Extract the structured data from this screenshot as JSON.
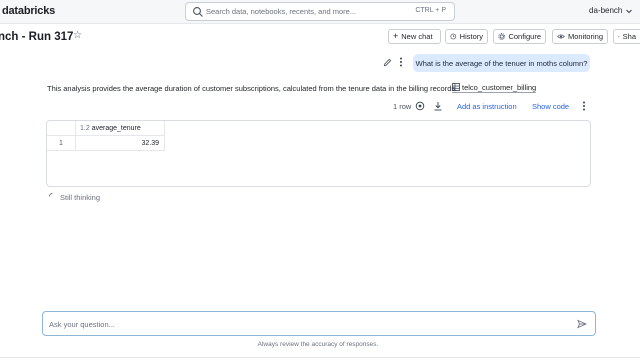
{
  "app": {
    "logo": "databricks",
    "search_placeholder": "Search data, notebooks, recents, and more...",
    "search_shortcut": "CTRL + P",
    "workspace": "da-bench"
  },
  "header": {
    "title": "nch - Run 317",
    "buttons": {
      "new_chat": "New chat",
      "history": "History",
      "configure": "Configure",
      "monitoring": "Monitoring",
      "share": "Sha"
    }
  },
  "conversation": {
    "user_question": "What is the average of the tenuer in moths column?",
    "answer_text": "This analysis provides the average duration of customer subscriptions, calculated from the tenure data in the billing records.",
    "table_tag": "telco_customer_billing",
    "result": {
      "row_count": "1 row",
      "add_instruction": "Add as instruction",
      "show_code": "Show code",
      "columns": [
        {
          "type": "1.2",
          "name": "average_tenure"
        }
      ],
      "rows": [
        {
          "index": "1",
          "values": [
            "32.39"
          ]
        }
      ]
    },
    "status": "Still thinking"
  },
  "composer": {
    "placeholder": "Ask your question...",
    "disclaimer": "Always review the accuracy of responses."
  },
  "icons": {
    "search": "search-icon",
    "star": "star-icon",
    "plus": "plus-icon",
    "history": "history-icon",
    "gear": "gear-icon",
    "eye": "eye-icon",
    "share": "share-icon",
    "pencil": "pencil-icon",
    "kebab": "kebab-icon",
    "table": "table-icon",
    "refresh": "refresh-icon",
    "download": "download-icon",
    "spinner": "spinner-icon",
    "send": "send-icon"
  },
  "colors": {
    "user_bubble": "#dbeafe",
    "link": "#2563eb",
    "composer_border": "#8fb6d8"
  }
}
